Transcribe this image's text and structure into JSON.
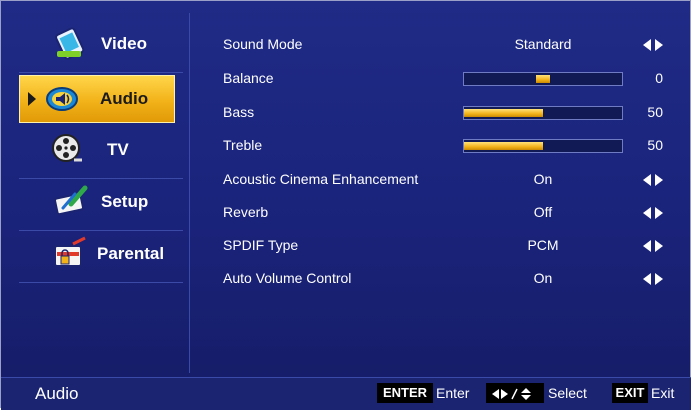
{
  "menu": {
    "items": [
      {
        "label": "Video",
        "icon": "video-icon"
      },
      {
        "label": "Audio",
        "icon": "speaker-icon",
        "selected": true
      },
      {
        "label": "TV",
        "icon": "film-reel-icon"
      },
      {
        "label": "Setup",
        "icon": "setup-tools-icon"
      },
      {
        "label": "Parental",
        "icon": "parental-lock-icon"
      }
    ]
  },
  "settings": [
    {
      "label": "Sound Mode",
      "value": "Standard"
    },
    {
      "label": "Balance",
      "number": "0",
      "level": 0.5
    },
    {
      "label": "Bass",
      "number": "50",
      "level": 0.5
    },
    {
      "label": "Treble",
      "number": "50",
      "level": 0.5
    },
    {
      "label": "Acoustic Cinema Enhancement",
      "value": "On"
    },
    {
      "label": "Reverb",
      "value": "Off"
    },
    {
      "label": "SPDIF Type",
      "value": "PCM"
    },
    {
      "label": "Auto Volume Control",
      "value": "On"
    }
  ],
  "footer": {
    "title": "Audio",
    "enter_key": "ENTER",
    "enter_label": "Enter",
    "select_label": "Select",
    "exit_key": "EXIT",
    "exit_label": "Exit"
  },
  "colors": {
    "background": "#1f2b86",
    "accent": "#f2b219",
    "bottom_bar": "#1b2470"
  }
}
